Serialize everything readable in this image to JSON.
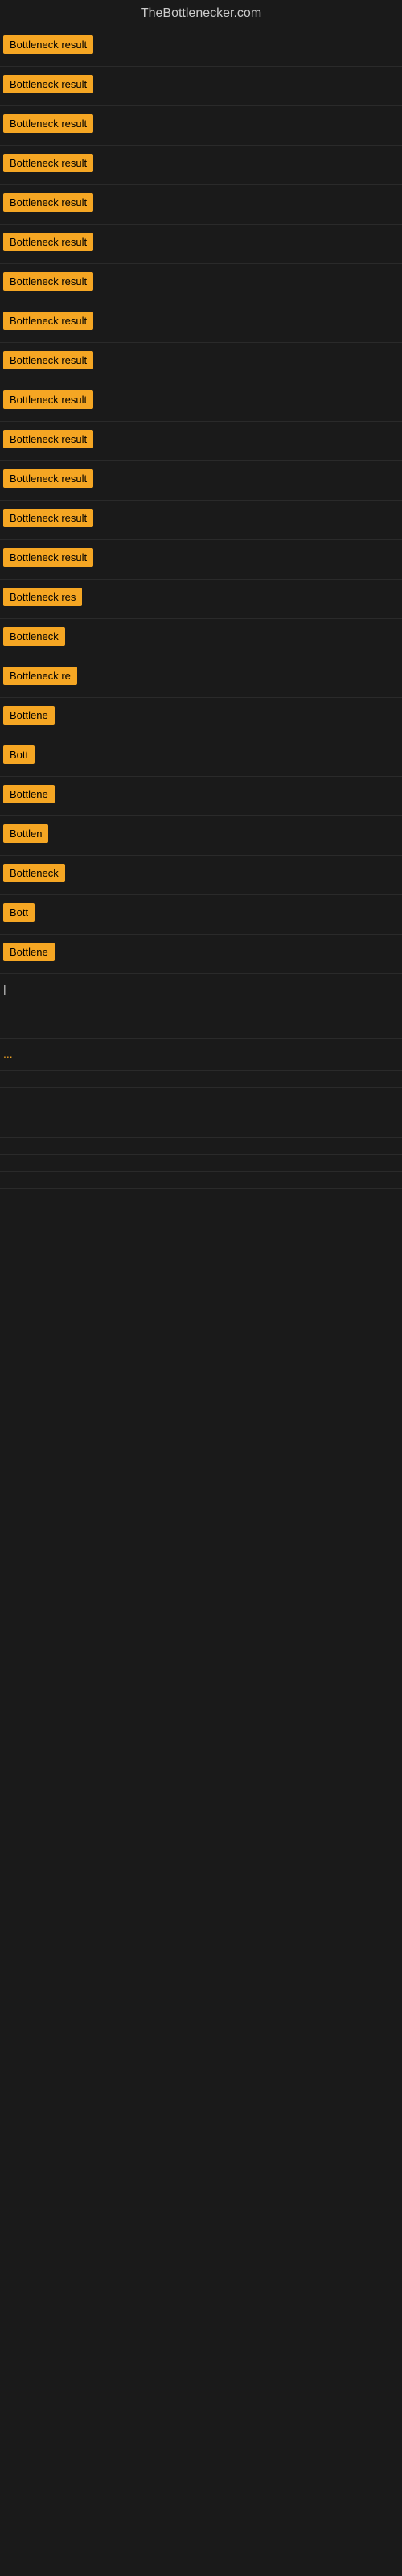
{
  "site": {
    "title": "TheBottlenecker.com"
  },
  "results": [
    {
      "id": 1,
      "label": "Bottleneck result",
      "width": 135
    },
    {
      "id": 2,
      "label": "Bottleneck result",
      "width": 135
    },
    {
      "id": 3,
      "label": "Bottleneck result",
      "width": 135
    },
    {
      "id": 4,
      "label": "Bottleneck result",
      "width": 135
    },
    {
      "id": 5,
      "label": "Bottleneck result",
      "width": 135
    },
    {
      "id": 6,
      "label": "Bottleneck result",
      "width": 135
    },
    {
      "id": 7,
      "label": "Bottleneck result",
      "width": 135
    },
    {
      "id": 8,
      "label": "Bottleneck result",
      "width": 135
    },
    {
      "id": 9,
      "label": "Bottleneck result",
      "width": 135
    },
    {
      "id": 10,
      "label": "Bottleneck result",
      "width": 135
    },
    {
      "id": 11,
      "label": "Bottleneck result",
      "width": 135
    },
    {
      "id": 12,
      "label": "Bottleneck result",
      "width": 135
    },
    {
      "id": 13,
      "label": "Bottleneck result",
      "width": 135
    },
    {
      "id": 14,
      "label": "Bottleneck result",
      "width": 135
    },
    {
      "id": 15,
      "label": "Bottleneck res",
      "width": 110
    },
    {
      "id": 16,
      "label": "Bottleneck",
      "width": 80
    },
    {
      "id": 17,
      "label": "Bottleneck re",
      "width": 95
    },
    {
      "id": 18,
      "label": "Bottlene",
      "width": 70
    },
    {
      "id": 19,
      "label": "Bott",
      "width": 42
    },
    {
      "id": 20,
      "label": "Bottlene",
      "width": 70
    },
    {
      "id": 21,
      "label": "Bottlen",
      "width": 62
    },
    {
      "id": 22,
      "label": "Bottleneck",
      "width": 80
    },
    {
      "id": 23,
      "label": "Bott",
      "width": 42
    },
    {
      "id": 24,
      "label": "Bottlene",
      "width": 70
    },
    {
      "id": 25,
      "label": "|",
      "width": 10
    },
    {
      "id": 26,
      "label": "",
      "width": 0
    },
    {
      "id": 27,
      "label": "",
      "width": 0
    },
    {
      "id": 28,
      "label": "...",
      "width": 20
    },
    {
      "id": 29,
      "label": "",
      "width": 0
    },
    {
      "id": 30,
      "label": "",
      "width": 0
    },
    {
      "id": 31,
      "label": "",
      "width": 0
    },
    {
      "id": 32,
      "label": "",
      "width": 0
    },
    {
      "id": 33,
      "label": "",
      "width": 0
    },
    {
      "id": 34,
      "label": "",
      "width": 0
    },
    {
      "id": 35,
      "label": "",
      "width": 0
    }
  ],
  "colors": {
    "badge_bg": "#f5a623",
    "badge_text": "#000000",
    "page_bg": "#1a1a1a",
    "title_text": "#cccccc"
  }
}
